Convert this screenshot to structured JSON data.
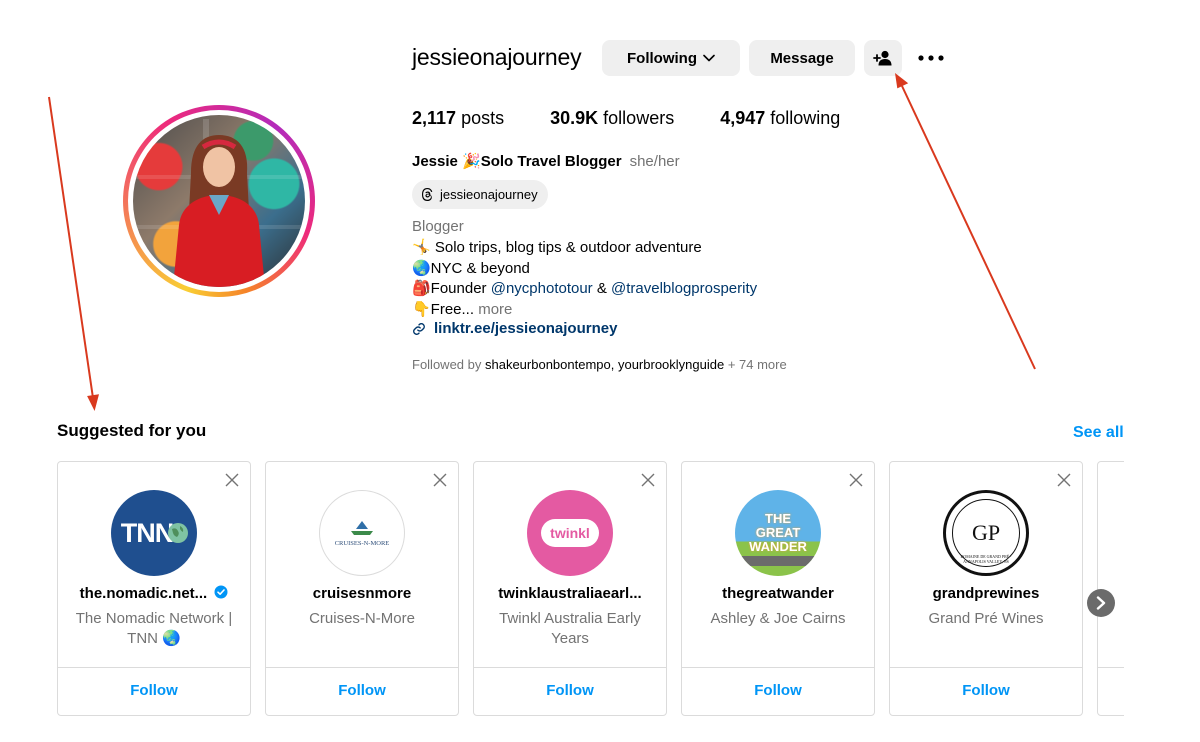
{
  "profile": {
    "username": "jessieonajourney",
    "following_label": "Following",
    "message_label": "Message",
    "stats": {
      "posts_count": "2,117",
      "posts_label": "posts",
      "followers_count": "30.9K",
      "followers_label": "followers",
      "following_count": "4,947",
      "following_label": "following"
    },
    "full_name": "Jessie 🎉Solo Travel Blogger",
    "pronouns": "she/her",
    "threads_handle": "jessieonajourney",
    "category": "Blogger",
    "bio": {
      "line1": "🤸 Solo trips, blog tips & outdoor adventure",
      "line2": "🌏NYC & beyond",
      "line3_prefix": "🎒Founder ",
      "line3_mention1": "@nycphototour",
      "line3_mid": " & ",
      "line3_mention2": "@travelblogprosperity",
      "line4": "👇Free... ",
      "line4_more": "more"
    },
    "link": "linktr.ee/jessieonajourney",
    "followed_by_prefix": "Followed by ",
    "followed_by_names": "shakeurbonbontempo, yourbrooklynguide",
    "followed_by_suffix": " + 74 more"
  },
  "suggested": {
    "title": "Suggested for you",
    "see_all": "See all",
    "cards": [
      {
        "handle": "the.nomadic.net...",
        "name": "The Nomadic Network | TNN 🌏",
        "follow": "Follow",
        "logo_text": "TNN",
        "verified": true
      },
      {
        "handle": "cruisesnmore",
        "name": "Cruises-N-More",
        "follow": "Follow",
        "logo_text": "CRUISES-N-MORE"
      },
      {
        "handle": "twinklaustraliaearl...",
        "name": "Twinkl Australia Early Years",
        "follow": "Follow",
        "logo_text": "twinkl"
      },
      {
        "handle": "thegreatwander",
        "name": "Ashley & Joe Cairns",
        "follow": "Follow",
        "logo_text": "THE GREAT WANDER"
      },
      {
        "handle": "grandprewines",
        "name": "Grand Pré Wines",
        "follow": "Follow",
        "logo_text": "GP",
        "logo_ring_text": "DOMAINE DE GRAND PRÉ · ANNAPOLIS VALLEY, NS"
      }
    ]
  },
  "colors": {
    "accent_blue": "#0095f6",
    "link_blue": "#00376b",
    "annotation_red": "#d9391e"
  }
}
